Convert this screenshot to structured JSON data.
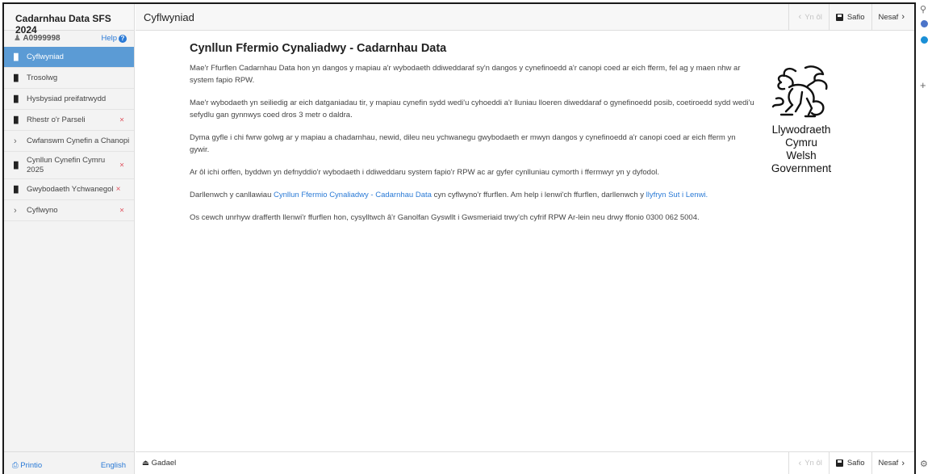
{
  "sidebar": {
    "title": "Cadarnhau Data SFS 2024",
    "user_id": "A0999998",
    "help_label": "Help",
    "items": [
      {
        "label": "Cyflwyniad",
        "active": true,
        "icon": "page-icon"
      },
      {
        "label": "Trosolwg",
        "icon": "page-icon"
      },
      {
        "label": "Hysbysiad preifatrwydd",
        "icon": "page-icon"
      },
      {
        "label": "Rhestr o'r Parseli",
        "icon": "page-icon",
        "error": "×"
      },
      {
        "label": "Cwfanswm Cynefin a Chanopi",
        "icon": "chevron-right-icon"
      },
      {
        "label": "Cynllun Cynefin Cymru 2025",
        "icon": "page-icon",
        "error": "×"
      },
      {
        "label": "Gwybodaeth Ychwanegol",
        "icon": "page-icon",
        "error": "×"
      },
      {
        "label": "Cyflwyno",
        "icon": "chevron-right-icon",
        "error": "×"
      }
    ],
    "print_label": "Printio",
    "language_label": "English"
  },
  "header": {
    "page_title": "Cyflwyniad",
    "back_label": "Yn ôl",
    "save_label": "Safio",
    "next_label": "Nesaf"
  },
  "content": {
    "heading": "Cynllun Ffermio Cynaliadwy - Cadarnhau Data",
    "p1": "Mae'r Ffurflen Cadarnhau Data hon yn dangos y mapiau a'r wybodaeth ddiweddaraf sy'n dangos y cynefinoedd a'r canopi coed ar eich fferm, fel ag y maen nhw ar system fapio RPW.",
    "p2": "Mae'r wybodaeth yn seiliedig ar eich datganiadau tir, y mapiau cynefin sydd wedi'u cyhoeddi a'r lluniau lloeren diweddaraf o gynefinoedd posib, coetiroedd sydd wedi'u sefydlu gan gynnwys coed dros 3 metr o daldra.",
    "p3": "Dyma gyfle i chi fwrw golwg ar y mapiau a chadarnhau, newid, dileu neu ychwanegu gwybodaeth er mwyn dangos y cynefinoedd a'r canopi coed ar eich fferm yn gywir.",
    "p4": "Ar ôl ichi orffen, byddwn yn defnyddio'r wybodaeth i ddiweddaru system fapio'r RPW ac ar gyfer cynlluniau cymorth i ffermwyr yn y dyfodol.",
    "p5_pre": "Darllenwch y canllawiau ",
    "p5_link1": "Cynllun Ffermio Cynaliadwy - Cadarnhau Data",
    "p5_mid": " cyn cyflwyno'r ffurflen. Am help i lenwi'ch ffurflen, darllenwch y ",
    "p5_link2": "llyfryn Sut i Lenwi.",
    "p6": "Os cewch unrhyw drafferth llenwi'r ffurflen hon, cysylltwch â'r Ganolfan Gyswllt i Gwsmeriaid trwy'ch cyfrif RPW Ar-lein neu drwy ffonio 0300 062 5004."
  },
  "logo": {
    "line1": "Llywodraeth Cymru",
    "line2": "Welsh Government",
    "icon": "welsh-dragon-icon"
  },
  "footer": {
    "exit_label": "Gadael",
    "back_label": "Yn ôl",
    "save_label": "Safio",
    "next_label": "Nesaf"
  },
  "colors": {
    "active": "#5b9bd5",
    "link": "#2a7ad6",
    "error": "#e0525e"
  }
}
